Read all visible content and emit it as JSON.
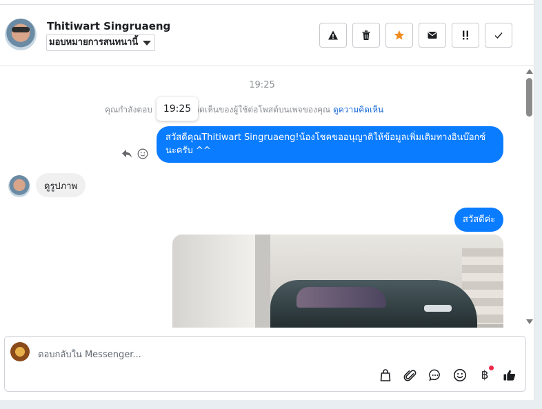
{
  "header": {
    "name": "Thitiwart Singruaeng",
    "assign_label": "มอบหมายการสนทนานี้",
    "actions": [
      {
        "name": "report-icon",
        "label": "!"
      },
      {
        "name": "trash-icon",
        "label": ""
      },
      {
        "name": "star-icon",
        "label": ""
      },
      {
        "name": "mail-icon",
        "label": ""
      },
      {
        "name": "important-icon",
        "label": "!!"
      },
      {
        "name": "check-icon",
        "label": ""
      }
    ],
    "star_color": "#f28b20"
  },
  "thread": {
    "timestamp": "19:25",
    "notice_text": "คุณกำลังตอบ",
    "notice_text_2": "คิดเห็นของผู้ใช้ต่อโพสต์บนเพจของคุณ",
    "notice_link": "ดูความคิดเห็น",
    "tooltip_time": "19:25",
    "messages": [
      {
        "from": "page",
        "text": "สวัสดีคุณThitiwart Singruaeng!น้องโชคขออนุญาติให้ข้อมูลเพิ่มเติมทางอินบ๊อกซ์นะครับ ^^"
      },
      {
        "from": "user",
        "text": "ดูรูปภาพ"
      },
      {
        "from": "page",
        "text": "สวัสดีค่ะ"
      }
    ],
    "bubble_color": "#0a7cff"
  },
  "composer": {
    "placeholder": "ตอบกลับใน Messenger...",
    "tools": [
      "bag-icon",
      "paperclip-icon",
      "chat-icon",
      "emoji-icon",
      "baht-icon",
      "thumbs-up-icon"
    ],
    "baht_symbol": "฿"
  }
}
